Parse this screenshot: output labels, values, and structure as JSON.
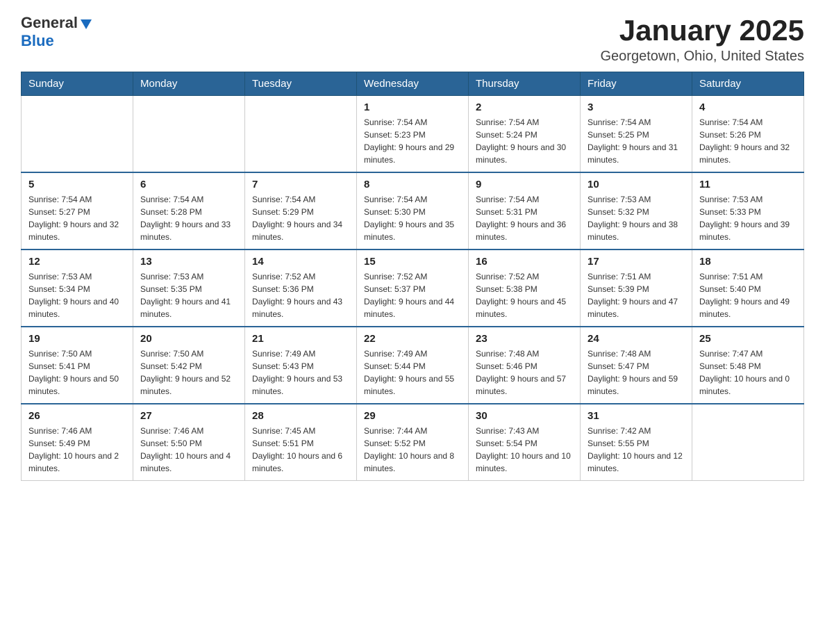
{
  "header": {
    "logo_general": "General",
    "logo_blue": "Blue",
    "month_title": "January 2025",
    "location": "Georgetown, Ohio, United States"
  },
  "weekdays": [
    "Sunday",
    "Monday",
    "Tuesday",
    "Wednesday",
    "Thursday",
    "Friday",
    "Saturday"
  ],
  "weeks": [
    [
      {
        "day": "",
        "sunrise": "",
        "sunset": "",
        "daylight": ""
      },
      {
        "day": "",
        "sunrise": "",
        "sunset": "",
        "daylight": ""
      },
      {
        "day": "",
        "sunrise": "",
        "sunset": "",
        "daylight": ""
      },
      {
        "day": "1",
        "sunrise": "Sunrise: 7:54 AM",
        "sunset": "Sunset: 5:23 PM",
        "daylight": "Daylight: 9 hours and 29 minutes."
      },
      {
        "day": "2",
        "sunrise": "Sunrise: 7:54 AM",
        "sunset": "Sunset: 5:24 PM",
        "daylight": "Daylight: 9 hours and 30 minutes."
      },
      {
        "day": "3",
        "sunrise": "Sunrise: 7:54 AM",
        "sunset": "Sunset: 5:25 PM",
        "daylight": "Daylight: 9 hours and 31 minutes."
      },
      {
        "day": "4",
        "sunrise": "Sunrise: 7:54 AM",
        "sunset": "Sunset: 5:26 PM",
        "daylight": "Daylight: 9 hours and 32 minutes."
      }
    ],
    [
      {
        "day": "5",
        "sunrise": "Sunrise: 7:54 AM",
        "sunset": "Sunset: 5:27 PM",
        "daylight": "Daylight: 9 hours and 32 minutes."
      },
      {
        "day": "6",
        "sunrise": "Sunrise: 7:54 AM",
        "sunset": "Sunset: 5:28 PM",
        "daylight": "Daylight: 9 hours and 33 minutes."
      },
      {
        "day": "7",
        "sunrise": "Sunrise: 7:54 AM",
        "sunset": "Sunset: 5:29 PM",
        "daylight": "Daylight: 9 hours and 34 minutes."
      },
      {
        "day": "8",
        "sunrise": "Sunrise: 7:54 AM",
        "sunset": "Sunset: 5:30 PM",
        "daylight": "Daylight: 9 hours and 35 minutes."
      },
      {
        "day": "9",
        "sunrise": "Sunrise: 7:54 AM",
        "sunset": "Sunset: 5:31 PM",
        "daylight": "Daylight: 9 hours and 36 minutes."
      },
      {
        "day": "10",
        "sunrise": "Sunrise: 7:53 AM",
        "sunset": "Sunset: 5:32 PM",
        "daylight": "Daylight: 9 hours and 38 minutes."
      },
      {
        "day": "11",
        "sunrise": "Sunrise: 7:53 AM",
        "sunset": "Sunset: 5:33 PM",
        "daylight": "Daylight: 9 hours and 39 minutes."
      }
    ],
    [
      {
        "day": "12",
        "sunrise": "Sunrise: 7:53 AM",
        "sunset": "Sunset: 5:34 PM",
        "daylight": "Daylight: 9 hours and 40 minutes."
      },
      {
        "day": "13",
        "sunrise": "Sunrise: 7:53 AM",
        "sunset": "Sunset: 5:35 PM",
        "daylight": "Daylight: 9 hours and 41 minutes."
      },
      {
        "day": "14",
        "sunrise": "Sunrise: 7:52 AM",
        "sunset": "Sunset: 5:36 PM",
        "daylight": "Daylight: 9 hours and 43 minutes."
      },
      {
        "day": "15",
        "sunrise": "Sunrise: 7:52 AM",
        "sunset": "Sunset: 5:37 PM",
        "daylight": "Daylight: 9 hours and 44 minutes."
      },
      {
        "day": "16",
        "sunrise": "Sunrise: 7:52 AM",
        "sunset": "Sunset: 5:38 PM",
        "daylight": "Daylight: 9 hours and 45 minutes."
      },
      {
        "day": "17",
        "sunrise": "Sunrise: 7:51 AM",
        "sunset": "Sunset: 5:39 PM",
        "daylight": "Daylight: 9 hours and 47 minutes."
      },
      {
        "day": "18",
        "sunrise": "Sunrise: 7:51 AM",
        "sunset": "Sunset: 5:40 PM",
        "daylight": "Daylight: 9 hours and 49 minutes."
      }
    ],
    [
      {
        "day": "19",
        "sunrise": "Sunrise: 7:50 AM",
        "sunset": "Sunset: 5:41 PM",
        "daylight": "Daylight: 9 hours and 50 minutes."
      },
      {
        "day": "20",
        "sunrise": "Sunrise: 7:50 AM",
        "sunset": "Sunset: 5:42 PM",
        "daylight": "Daylight: 9 hours and 52 minutes."
      },
      {
        "day": "21",
        "sunrise": "Sunrise: 7:49 AM",
        "sunset": "Sunset: 5:43 PM",
        "daylight": "Daylight: 9 hours and 53 minutes."
      },
      {
        "day": "22",
        "sunrise": "Sunrise: 7:49 AM",
        "sunset": "Sunset: 5:44 PM",
        "daylight": "Daylight: 9 hours and 55 minutes."
      },
      {
        "day": "23",
        "sunrise": "Sunrise: 7:48 AM",
        "sunset": "Sunset: 5:46 PM",
        "daylight": "Daylight: 9 hours and 57 minutes."
      },
      {
        "day": "24",
        "sunrise": "Sunrise: 7:48 AM",
        "sunset": "Sunset: 5:47 PM",
        "daylight": "Daylight: 9 hours and 59 minutes."
      },
      {
        "day": "25",
        "sunrise": "Sunrise: 7:47 AM",
        "sunset": "Sunset: 5:48 PM",
        "daylight": "Daylight: 10 hours and 0 minutes."
      }
    ],
    [
      {
        "day": "26",
        "sunrise": "Sunrise: 7:46 AM",
        "sunset": "Sunset: 5:49 PM",
        "daylight": "Daylight: 10 hours and 2 minutes."
      },
      {
        "day": "27",
        "sunrise": "Sunrise: 7:46 AM",
        "sunset": "Sunset: 5:50 PM",
        "daylight": "Daylight: 10 hours and 4 minutes."
      },
      {
        "day": "28",
        "sunrise": "Sunrise: 7:45 AM",
        "sunset": "Sunset: 5:51 PM",
        "daylight": "Daylight: 10 hours and 6 minutes."
      },
      {
        "day": "29",
        "sunrise": "Sunrise: 7:44 AM",
        "sunset": "Sunset: 5:52 PM",
        "daylight": "Daylight: 10 hours and 8 minutes."
      },
      {
        "day": "30",
        "sunrise": "Sunrise: 7:43 AM",
        "sunset": "Sunset: 5:54 PM",
        "daylight": "Daylight: 10 hours and 10 minutes."
      },
      {
        "day": "31",
        "sunrise": "Sunrise: 7:42 AM",
        "sunset": "Sunset: 5:55 PM",
        "daylight": "Daylight: 10 hours and 12 minutes."
      },
      {
        "day": "",
        "sunrise": "",
        "sunset": "",
        "daylight": ""
      }
    ]
  ]
}
